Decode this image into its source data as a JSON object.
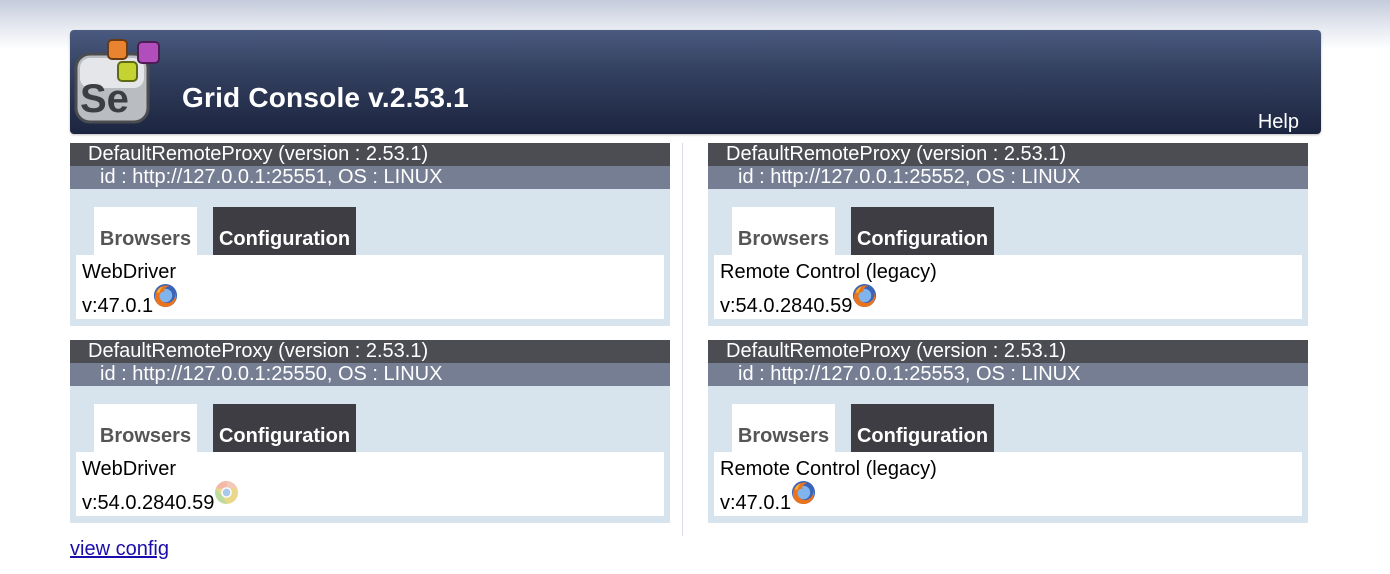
{
  "header": {
    "title": "Grid Console v.2.53.1",
    "help_label": "Help",
    "logo_text": "Se"
  },
  "columns": {
    "left": [
      {
        "title": "DefaultRemoteProxy (version : 2.53.1)",
        "id_line": "id : http://127.0.0.1:25551, OS : LINUX",
        "tab_browsers": "Browsers",
        "tab_config": "Configuration",
        "protocol": "WebDriver",
        "version": "v:47.0.1",
        "browser_icon": "firefox-icon"
      },
      {
        "title": "DefaultRemoteProxy (version : 2.53.1)",
        "id_line": "id : http://127.0.0.1:25550, OS : LINUX",
        "tab_browsers": "Browsers",
        "tab_config": "Configuration",
        "protocol": "WebDriver",
        "version": "v:54.0.2840.59",
        "browser_icon": "chrome-icon"
      }
    ],
    "right": [
      {
        "title": "DefaultRemoteProxy (version : 2.53.1)",
        "id_line": "id : http://127.0.0.1:25552, OS : LINUX",
        "tab_browsers": "Browsers",
        "tab_config": "Configuration",
        "protocol": "Remote Control (legacy)",
        "version": "v:54.0.2840.59",
        "browser_icon": "firefox-icon"
      },
      {
        "title": "DefaultRemoteProxy (version : 2.53.1)",
        "id_line": "id : http://127.0.0.1:25553, OS : LINUX",
        "tab_browsers": "Browsers",
        "tab_config": "Configuration",
        "protocol": "Remote Control (legacy)",
        "version": "v:47.0.1",
        "browser_icon": "firefox-icon"
      }
    ]
  },
  "footer": {
    "view_config_label": "view config"
  },
  "colors": {
    "header_dark": "#1c2540",
    "header_light": "#4a5a80",
    "proxy_title_bg": "#4b4d53",
    "proxy_id_bg": "#767e93",
    "proxy_body_bg": "#d7e4ee",
    "config_tab_bg": "#3d3d43",
    "link": "#1a0dab"
  }
}
